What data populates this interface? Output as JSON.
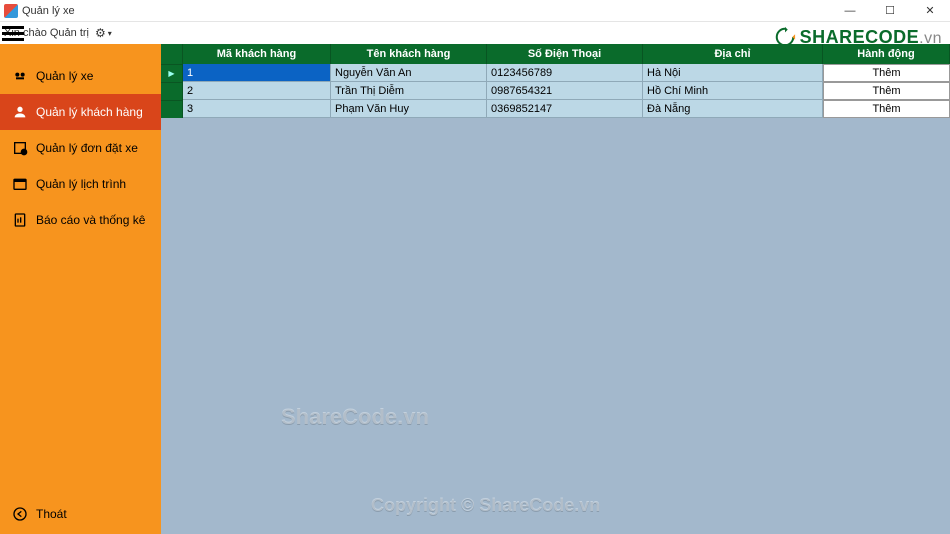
{
  "window": {
    "title": "Quản lý xe"
  },
  "topstrip": {
    "greeting": "Xin chào Quản trị"
  },
  "brand": {
    "text_main": "SHARECODE",
    "text_suffix": ".vn"
  },
  "sidebar": {
    "items": [
      {
        "label": "Quản lý xe"
      },
      {
        "label": "Quản lý khách hàng"
      },
      {
        "label": "Quản lý đơn đặt xe"
      },
      {
        "label": "Quản lý lịch trình"
      },
      {
        "label": "Báo cáo và thống kê"
      }
    ],
    "exit_label": "Thoát"
  },
  "grid": {
    "columns": [
      "Mã khách hàng",
      "Tên khách hàng",
      "Số Điện Thoại",
      "Địa chỉ",
      "Hành động"
    ],
    "action_label": "Thêm",
    "rows": [
      {
        "id": "1",
        "name": "Nguyễn Văn An",
        "phone": "0123456789",
        "address": "Hà Nội"
      },
      {
        "id": "2",
        "name": "Trần Thị Diễm",
        "phone": "0987654321",
        "address": "Hồ Chí Minh"
      },
      {
        "id": "3",
        "name": "Phạm Văn Huy",
        "phone": "0369852147",
        "address": "Đà Nẵng"
      }
    ]
  },
  "watermarks": {
    "wm1": "ShareCode.vn",
    "wm2": "Copyright © ShareCode.vn"
  }
}
